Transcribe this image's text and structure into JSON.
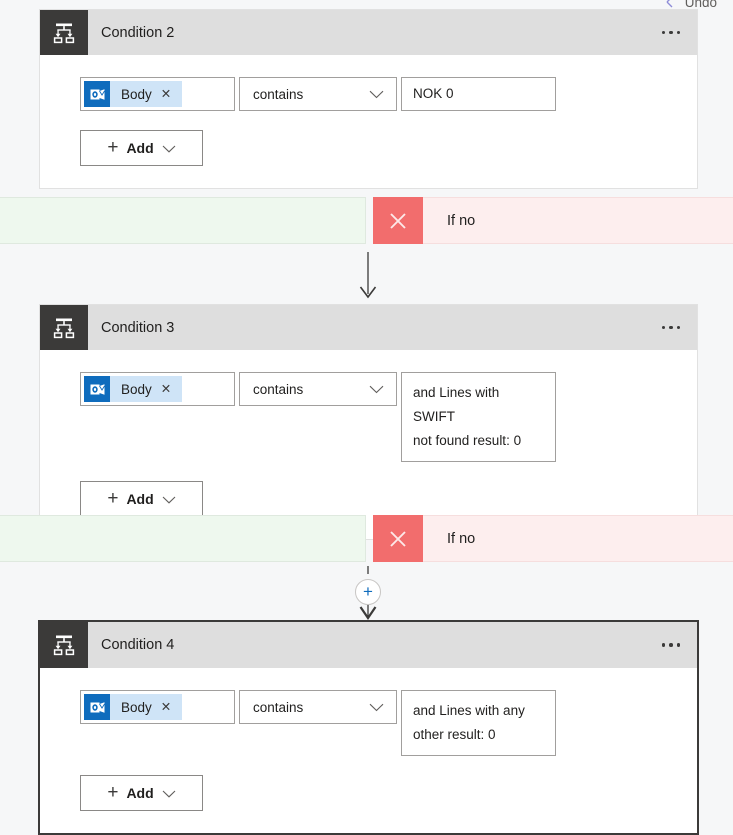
{
  "toolbar": {
    "undo_label": "Undo",
    "undo_icon": "undo-arrow-icon"
  },
  "flow": {
    "cards": [
      {
        "id": "condition-2",
        "title": "Condition 2",
        "icon": "condition-branch-icon",
        "menu_icon": "more-options-icon",
        "selected": false,
        "row": {
          "token": {
            "label": "Body",
            "icon": "outlook-icon",
            "remove_icon": "remove-token-icon",
            "remove_glyph": "✕"
          },
          "operator": {
            "value": "contains",
            "chevron_icon": "chevron-down-icon"
          },
          "value_lines": [
            "NOK 0"
          ]
        },
        "add_button": {
          "label": "Add",
          "plus_icon": "plus-icon",
          "plus_glyph": "＋",
          "chevron_icon": "chevron-down-icon"
        }
      },
      {
        "id": "condition-3",
        "title": "Condition 3",
        "icon": "condition-branch-icon",
        "menu_icon": "more-options-icon",
        "selected": false,
        "row": {
          "token": {
            "label": "Body",
            "icon": "outlook-icon",
            "remove_icon": "remove-token-icon",
            "remove_glyph": "✕"
          },
          "operator": {
            "value": "contains",
            "chevron_icon": "chevron-down-icon"
          },
          "value_lines": [
            "and Lines with SWIFT",
            "not found result: 0"
          ]
        },
        "add_button": {
          "label": "Add",
          "plus_icon": "plus-icon",
          "plus_glyph": "＋",
          "chevron_icon": "chevron-down-icon"
        }
      },
      {
        "id": "condition-4",
        "title": "Condition 4",
        "icon": "condition-branch-icon",
        "menu_icon": "more-options-icon",
        "selected": true,
        "row": {
          "token": {
            "label": "Body",
            "icon": "outlook-icon",
            "remove_icon": "remove-token-icon",
            "remove_glyph": "✕"
          },
          "operator": {
            "value": "contains",
            "chevron_icon": "chevron-down-icon"
          },
          "value_lines": [
            "and Lines with any",
            "other result: 0"
          ]
        },
        "add_button": {
          "label": "Add",
          "plus_icon": "plus-icon",
          "plus_glyph": "＋",
          "chevron_icon": "chevron-down-icon"
        }
      }
    ],
    "branches": [
      {
        "id": "branch-1",
        "no_label": "If no",
        "x_icon": "close-x-icon"
      },
      {
        "id": "branch-2",
        "no_label": "If no",
        "x_icon": "close-x-icon"
      }
    ],
    "connectors": [
      {
        "id": "connector-1",
        "type": "arrow",
        "icon": "arrow-down-icon"
      },
      {
        "id": "connector-2",
        "type": "arrow-with-insert",
        "icon": "arrow-down-icon",
        "insert_icon": "insert-step-icon",
        "insert_glyph": "＋"
      }
    ]
  },
  "colors": {
    "accent": "#0f6cbd",
    "header_gray": "#dedede",
    "icon_block": "#3b3a39",
    "branch_yes_bg": "#eef8ee",
    "branch_no_bg": "#fdeeee",
    "branch_x_bg": "#f26d6d",
    "token_bg": "#cfe4f7",
    "selected_border": "#3b3a39",
    "page_bg": "#f6f7f8"
  }
}
